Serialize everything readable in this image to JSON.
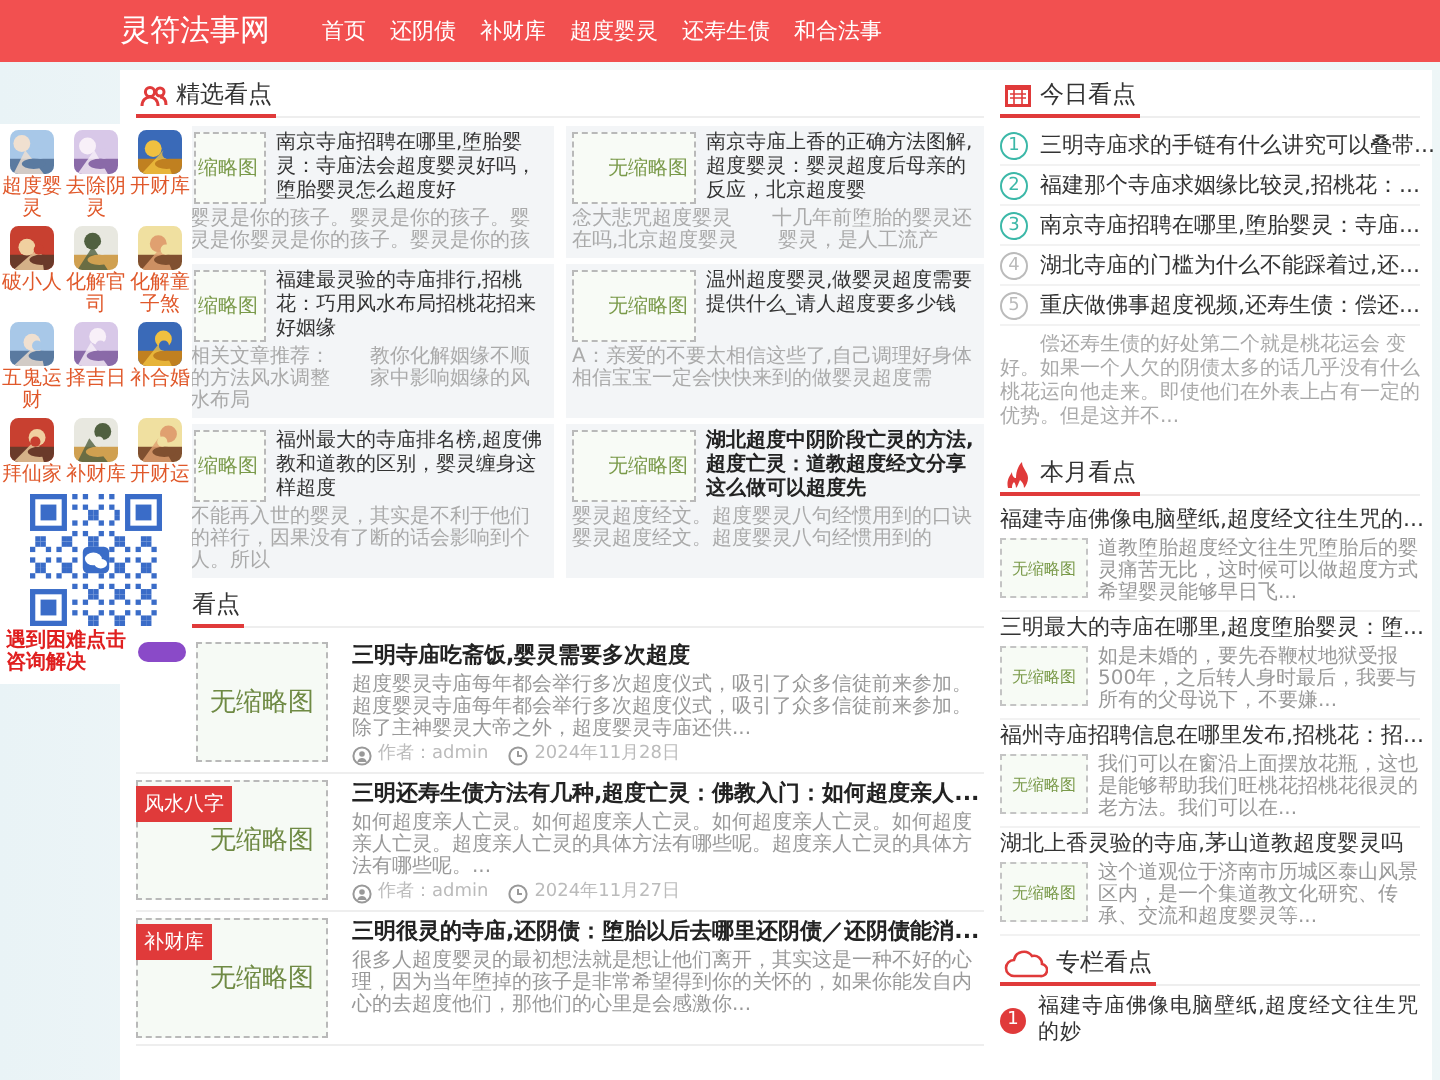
{
  "site": {
    "name": "灵符法事网",
    "nav": [
      {
        "label": "首页"
      },
      {
        "label": "还阴债"
      },
      {
        "label": "补财库"
      },
      {
        "label": "超度婴灵"
      },
      {
        "label": "还寿生债"
      },
      {
        "label": "和合法事"
      }
    ]
  },
  "float_ad": {
    "apps": [
      {
        "label": "超度婴灵"
      },
      {
        "label": "去除阴灵"
      },
      {
        "label": "开财库"
      },
      {
        "label": "破小人"
      },
      {
        "label": "化解官司"
      },
      {
        "label": "化解童子煞"
      },
      {
        "label": "五鬼运财"
      },
      {
        "label": "择吉日"
      },
      {
        "label": "补合婚"
      },
      {
        "label": "拜仙家"
      },
      {
        "label": "补财库"
      },
      {
        "label": "开财运"
      }
    ],
    "notice": "遇到困难点击咨询解决"
  },
  "featured": {
    "title": "精选看点",
    "items": [
      {
        "title": "南京寺庙招聘在哪里,堕胎婴灵：寺庙法会超度婴灵好吗，堕胎婴灵怎么超度好",
        "desc": "婴灵是你的孩子。婴灵是你的孩子。婴灵是你婴灵是你的孩子。婴灵是你的孩",
        "thumb": "缩略图",
        "bold": false
      },
      {
        "title": "南京寺庙上香的正确方法图解,超度婴灵：婴灵超度后母亲的反应，北京超度婴",
        "desc": "念大悲咒超度婴灵　　十几年前堕胎的婴灵还在吗,北京超度婴灵　　婴灵，是人工流产",
        "thumb": "无缩略图",
        "bold": false
      },
      {
        "title": "福建最灵验的寺庙排行,招桃花：巧用风水布局招桃花招来好姻缘",
        "desc": "相关文章推荐：　　教你化解姻缘不顺的方法风水调整　　家中影响姻缘的风水布局",
        "thumb": "缩略图",
        "bold": false
      },
      {
        "title": "温州超度婴灵,做婴灵超度需要提供什么_请人超度要多少钱",
        "desc": "A：亲爱的不要太相信这些了,自己调理好身体相信宝宝一定会快快来到的做婴灵超度需",
        "thumb": "无缩略图",
        "bold": false
      },
      {
        "title": "福州最大的寺庙排名榜,超度佛教和道教的区别，婴灵缠身这样超度",
        "desc": "不能再入世的婴灵，其实是不利于他们的祥行，因果没有了断的话会影响到个人。所以",
        "thumb": "缩略图",
        "bold": false
      },
      {
        "title": "湖北超度中阴阶段亡灵的方法,超度亡灵：道教超度经文分享这么做可以超度先",
        "desc": "婴灵超度经文。超度婴灵八句经惯用到的口诀婴灵超度经文。超度婴灵八句经惯用到的",
        "thumb": "无缩略图",
        "bold": true
      }
    ]
  },
  "latest": {
    "title": "看点",
    "articles": [
      {
        "title": "三明寺庙吃斋饭,婴灵需要多次超度",
        "desc": "超度婴灵寺庙每年都会举行多次超度仪式，吸引了众多信徒前来参加。超度婴灵寺庙每年都会举行多次超度仪式，吸引了众多信徒前来参加。除了主神婴灵大帝之外，超度婴灵寺庙还供...",
        "thumb": "无缩略图",
        "author": "作者：admin",
        "date": "2024年11月28日"
      },
      {
        "tag": "风水八字",
        "title": "三明还寿生债方法有几种,超度亡灵：佛教入门：如何超度亲人...",
        "desc": "如何超度亲人亡灵。如何超度亲人亡灵。如何超度亲人亡灵。如何超度亲人亡灵。超度亲人亡灵的具体方法有哪些呢。超度亲人亡灵的具体方法有哪些呢。...",
        "thumb": "无缩略图",
        "author": "作者：admin",
        "date": "2024年11月27日"
      },
      {
        "tag": "补财库",
        "title": "三明很灵的寺庙,还阴债：堕胎以后去哪里还阴债／还阴债能消...",
        "desc": "很多人超度婴灵的最初想法就是想让他们离开，其实这是一种不好的心理，因为当年堕掉的孩子是非常希望得到你的关怀的，如果你能发自内心的去超度他们，那他们的心里是会感激你...",
        "thumb": "无缩略图"
      }
    ]
  },
  "today": {
    "title": "今日看点",
    "items": [
      {
        "number": "1",
        "title": "三明寺庙求的手链有什么讲究可以叠带...",
        "color": "#3bb8a8"
      },
      {
        "number": "2",
        "title": "福建那个寺庙求姻缘比较灵,招桃花：...",
        "color": "#3bb8a8"
      },
      {
        "number": "3",
        "title": "南京寺庙招聘在哪里,堕胎婴灵：寺庙...",
        "color": "#3bb8a8"
      },
      {
        "number": "4",
        "title": "湖北寺庙的门槛为什么不能踩着过,还...",
        "color": "#bbbbbb"
      },
      {
        "number": "5",
        "title": "重庆做佛事超度视频,还寿生债：偿还...",
        "color": "#bbbbbb"
      }
    ],
    "summary": "偿还寿生债的好处第二个就是桃花运会 变好。如果一个人欠的阴债太多的话几乎没有什么桃花运向他走来。即使他们在外表上占有一定的优势。但是这并不..."
  },
  "month": {
    "title": "本月看点",
    "items": [
      {
        "title": "福建寺庙佛像电脑壁纸,超度经文往生咒的...",
        "desc": "道教堕胎超度经文往生咒堕胎后的婴灵痛苦无比，这时候可以做超度方式希望婴灵能够早日飞...",
        "thumb": "无缩略图"
      },
      {
        "title": "三明最大的寺庙在哪里,超度堕胎婴灵：堕...",
        "desc": "如是未婚的，要先吞鞭杖地狱受报500年，之后转人身时最后，我要与所有的父母说下，不要嫌...",
        "thumb": "无缩略图"
      },
      {
        "title": "福州寺庙招聘信息在哪里发布,招桃花：招...",
        "desc": "我们可以在窗沿上面摆放花瓶，这也是能够帮助我们旺桃花招桃花很灵的老方法。我们可以在...",
        "thumb": "无缩略图"
      },
      {
        "title": "湖北上香灵验的寺庙,茅山道教超度婴灵吗",
        "desc": "这个道观位于济南市历城区泰山风景区内，是一个集道教文化研究、传承、交流和超度婴灵等...",
        "thumb": "无缩略图"
      }
    ]
  },
  "column": {
    "title": "专栏看点",
    "items": [
      {
        "number": "1",
        "title": "福建寺庙佛像电脑壁纸,超度经文往生咒的妙"
      }
    ]
  }
}
